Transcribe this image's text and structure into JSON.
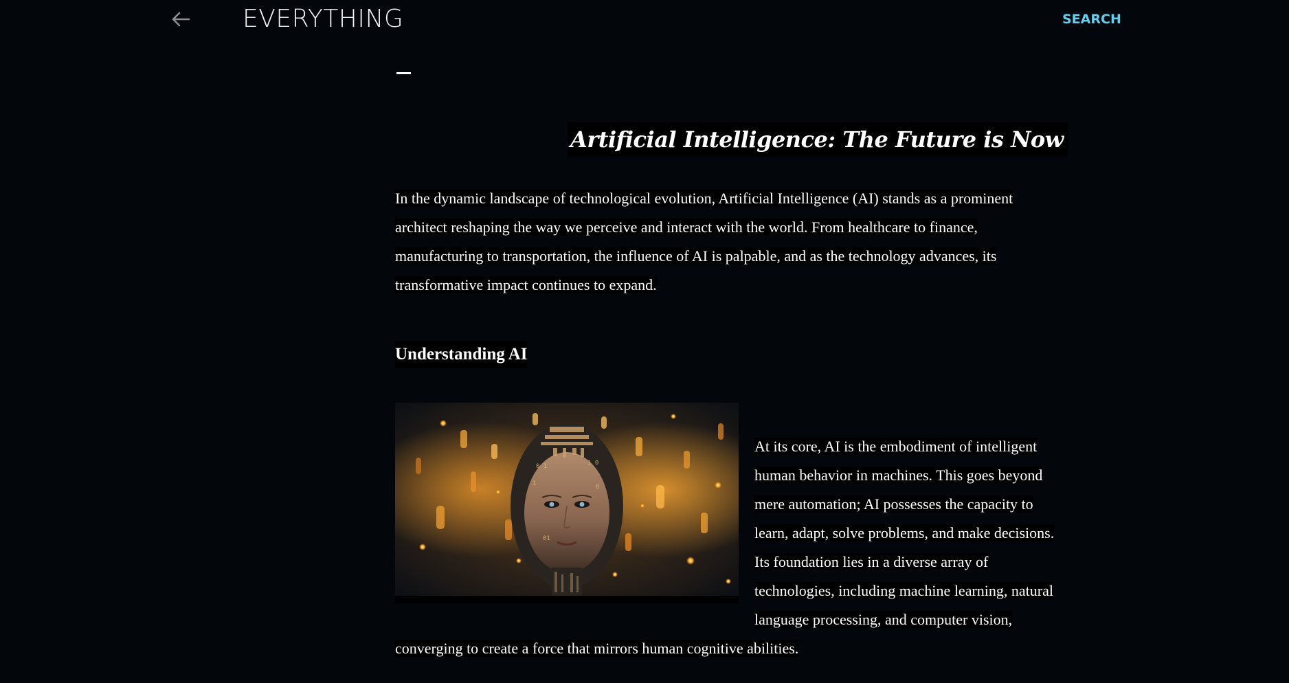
{
  "header": {
    "back_icon": "arrow-left-icon",
    "site_title": "EVERYTHING",
    "search_label": "SEARCH"
  },
  "colors": {
    "background": "#03060b",
    "text": "#ffffff",
    "accent": "#5fd0ee",
    "text_highlight": "#000000"
  },
  "article": {
    "title": "Artificial Intelligence: The Future is Now",
    "intro_lines": [
      "In the dynamic landscape of technological evolution, Artificial Intelligence (AI) stands as a prominent",
      "architect reshaping the way we perceive and interact with the world. From healthcare to finance,",
      "manufacturing to transportation, the influence of AI is palpable, and as the technology advances, its",
      "transformative impact continues to expand."
    ],
    "section_heading": "Understanding AI",
    "section_lines": [
      "At its core, AI is the embodiment of intelligent",
      "human behavior in machines. This goes beyond",
      "mere automation; AI possesses the capacity to",
      "learn, adapt, solve problems, and make decisions.",
      "Its foundation lies in a diverse array of",
      "technologies, including machine learning, natural",
      "language processing, and computer vision,",
      "converging to create a force that mirrors human cognitive abilities."
    ],
    "image_subject": "ai-humanoid-face-image"
  }
}
